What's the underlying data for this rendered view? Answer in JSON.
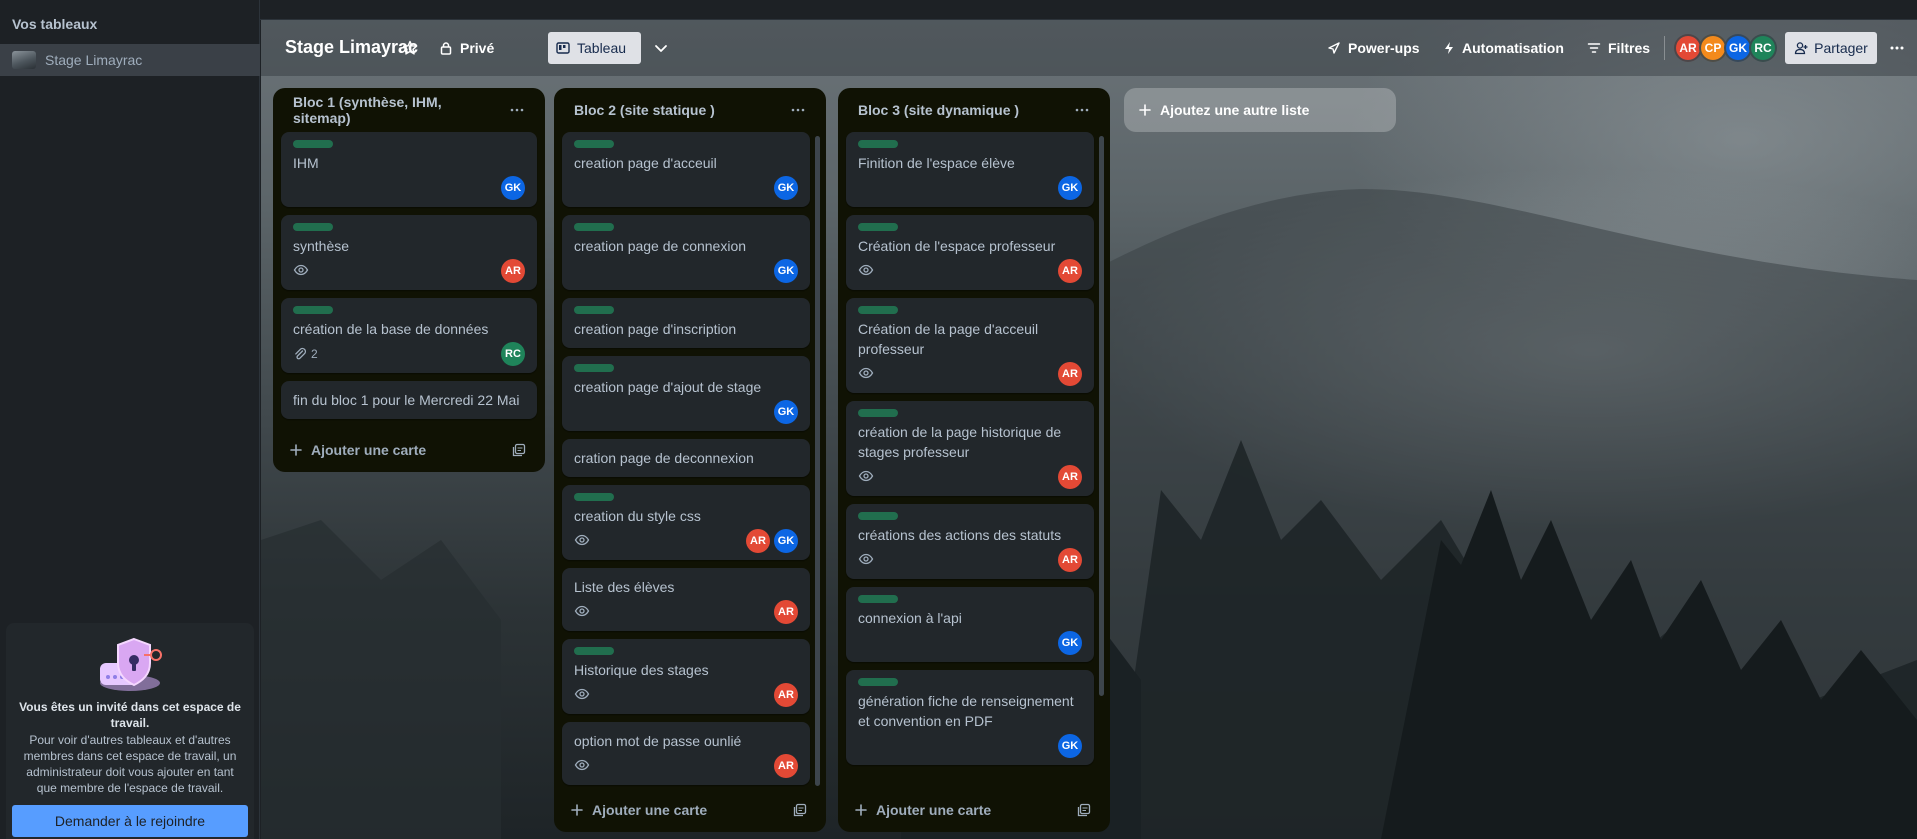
{
  "sidebar": {
    "heading": "Vos tableaux",
    "boards": [
      {
        "label": "Stage Limayrac"
      }
    ],
    "invite": {
      "title": "Vous êtes un invité dans cet espace de travail.",
      "text": "Pour voir d'autres tableaux et d'autres membres dans cet espace de travail, un administrateur doit vous ajouter en tant que membre de l'espace de travail.",
      "button": "Demander à le rejoindre"
    }
  },
  "header": {
    "title": "Stage Limayrac",
    "visibility": "Privé",
    "view": "Tableau",
    "power_ups": "Power-ups",
    "automation": "Automatisation",
    "filters": "Filtres",
    "members": [
      "AR",
      "CP",
      "GK",
      "RC"
    ],
    "share": "Partager"
  },
  "lists": [
    {
      "title": "Bloc 1 (synthèse, IHM, sitemap)",
      "add_card": "Ajouter une carte",
      "cards": [
        {
          "title": "IHM",
          "label": true,
          "members": [
            "GK"
          ]
        },
        {
          "title": "synthèse",
          "label": true,
          "watch": true,
          "members": [
            "AR"
          ]
        },
        {
          "title": "création de la base de données",
          "label": true,
          "attachments": "2",
          "members": [
            "RC"
          ]
        },
        {
          "title": "fin du bloc 1 pour le Mercredi 22 Mai",
          "label": false,
          "members": []
        }
      ]
    },
    {
      "title": "Bloc 2 (site statique )",
      "add_card": "Ajouter une carte",
      "cards": [
        {
          "title": "creation page d'acceuil",
          "label": true,
          "members": [
            "GK"
          ]
        },
        {
          "title": "creation page de connexion",
          "label": true,
          "members": [
            "GK"
          ]
        },
        {
          "title": "creation page d'inscription",
          "label": true,
          "members": []
        },
        {
          "title": "creation page d'ajout de stage",
          "label": true,
          "members": [
            "GK"
          ]
        },
        {
          "title": "cration page de deconnexion",
          "label": false,
          "members": []
        },
        {
          "title": "creation du style css",
          "label": true,
          "watch": true,
          "members": [
            "AR",
            "GK"
          ]
        },
        {
          "title": "Liste des élèves",
          "label": false,
          "watch": true,
          "members": [
            "AR"
          ]
        },
        {
          "title": "Historique des stages",
          "label": true,
          "watch": true,
          "members": [
            "AR"
          ]
        },
        {
          "title": "option mot de passe ounlié",
          "label": false,
          "watch": true,
          "members": [
            "AR"
          ]
        }
      ]
    },
    {
      "title": "Bloc 3 (site dynamique )",
      "add_card": "Ajouter une carte",
      "cards": [
        {
          "title": "Finition de l'espace élève",
          "label": true,
          "members": [
            "GK"
          ]
        },
        {
          "title": "Création de l'espace professeur",
          "label": true,
          "watch": true,
          "members": [
            "AR"
          ]
        },
        {
          "title": "Création de la page d'acceuil professeur",
          "label": true,
          "watch": true,
          "members": [
            "AR"
          ]
        },
        {
          "title": "création de la page historique de stages professeur",
          "label": true,
          "watch": true,
          "members": [
            "AR"
          ]
        },
        {
          "title": "créations des actions des statuts",
          "label": true,
          "watch": true,
          "members": [
            "AR"
          ]
        },
        {
          "title": "connexion à l'api",
          "label": true,
          "members": [
            "GK"
          ]
        },
        {
          "title": "génération fiche de renseignement et convention en PDF",
          "label": true,
          "members": [
            "GK"
          ]
        }
      ]
    }
  ],
  "add_list": "Ajoutez une autre liste",
  "colors": {
    "label_green": "#216e4e",
    "avatar_AR": "#e34935",
    "avatar_GK": "#0c66e4",
    "avatar_RC": "#1f845a",
    "avatar_CP": "#f38a1c",
    "join_button": "#579dff"
  },
  "icons": {
    "star": "star-icon",
    "visibility": "lock-icon",
    "view": "board-icon",
    "view_switch": "chevron-down-icon",
    "power_ups": "rocket-icon",
    "automation": "lightning-icon",
    "filters": "filter-icon",
    "share": "add-person-icon",
    "more": "ellipsis-icon",
    "watch": "eye-icon",
    "attachment": "paperclip-icon",
    "add": "plus-icon",
    "template": "card-template-icon"
  }
}
